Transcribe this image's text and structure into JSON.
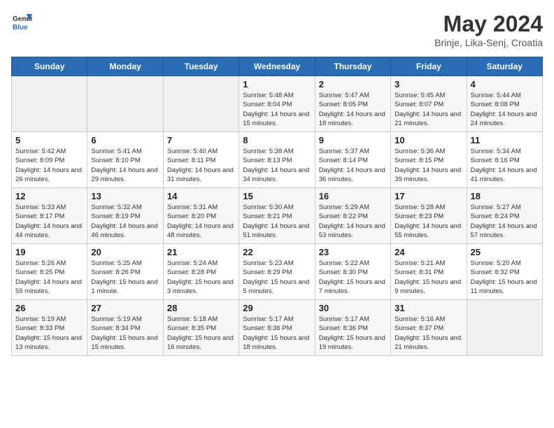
{
  "logo": {
    "general": "General",
    "blue": "Blue"
  },
  "header": {
    "month": "May 2024",
    "location": "Brinje, Lika-Senj, Croatia"
  },
  "days_of_week": [
    "Sunday",
    "Monday",
    "Tuesday",
    "Wednesday",
    "Thursday",
    "Friday",
    "Saturday"
  ],
  "weeks": [
    [
      {
        "day": "",
        "info": ""
      },
      {
        "day": "",
        "info": ""
      },
      {
        "day": "",
        "info": ""
      },
      {
        "day": "1",
        "info": "Sunrise: 5:48 AM\nSunset: 8:04 PM\nDaylight: 14 hours and 15 minutes."
      },
      {
        "day": "2",
        "info": "Sunrise: 5:47 AM\nSunset: 8:05 PM\nDaylight: 14 hours and 18 minutes."
      },
      {
        "day": "3",
        "info": "Sunrise: 5:45 AM\nSunset: 8:07 PM\nDaylight: 14 hours and 21 minutes."
      },
      {
        "day": "4",
        "info": "Sunrise: 5:44 AM\nSunset: 8:08 PM\nDaylight: 14 hours and 24 minutes."
      }
    ],
    [
      {
        "day": "5",
        "info": "Sunrise: 5:42 AM\nSunset: 8:09 PM\nDaylight: 14 hours and 26 minutes."
      },
      {
        "day": "6",
        "info": "Sunrise: 5:41 AM\nSunset: 8:10 PM\nDaylight: 14 hours and 29 minutes."
      },
      {
        "day": "7",
        "info": "Sunrise: 5:40 AM\nSunset: 8:11 PM\nDaylight: 14 hours and 31 minutes."
      },
      {
        "day": "8",
        "info": "Sunrise: 5:38 AM\nSunset: 8:13 PM\nDaylight: 14 hours and 34 minutes."
      },
      {
        "day": "9",
        "info": "Sunrise: 5:37 AM\nSunset: 8:14 PM\nDaylight: 14 hours and 36 minutes."
      },
      {
        "day": "10",
        "info": "Sunrise: 5:36 AM\nSunset: 8:15 PM\nDaylight: 14 hours and 39 minutes."
      },
      {
        "day": "11",
        "info": "Sunrise: 5:34 AM\nSunset: 8:16 PM\nDaylight: 14 hours and 41 minutes."
      }
    ],
    [
      {
        "day": "12",
        "info": "Sunrise: 5:33 AM\nSunset: 8:17 PM\nDaylight: 14 hours and 44 minutes."
      },
      {
        "day": "13",
        "info": "Sunrise: 5:32 AM\nSunset: 8:19 PM\nDaylight: 14 hours and 46 minutes."
      },
      {
        "day": "14",
        "info": "Sunrise: 5:31 AM\nSunset: 8:20 PM\nDaylight: 14 hours and 48 minutes."
      },
      {
        "day": "15",
        "info": "Sunrise: 5:30 AM\nSunset: 8:21 PM\nDaylight: 14 hours and 51 minutes."
      },
      {
        "day": "16",
        "info": "Sunrise: 5:29 AM\nSunset: 8:22 PM\nDaylight: 14 hours and 53 minutes."
      },
      {
        "day": "17",
        "info": "Sunrise: 5:28 AM\nSunset: 8:23 PM\nDaylight: 14 hours and 55 minutes."
      },
      {
        "day": "18",
        "info": "Sunrise: 5:27 AM\nSunset: 8:24 PM\nDaylight: 14 hours and 57 minutes."
      }
    ],
    [
      {
        "day": "19",
        "info": "Sunrise: 5:26 AM\nSunset: 8:25 PM\nDaylight: 14 hours and 59 minutes."
      },
      {
        "day": "20",
        "info": "Sunrise: 5:25 AM\nSunset: 8:26 PM\nDaylight: 15 hours and 1 minute."
      },
      {
        "day": "21",
        "info": "Sunrise: 5:24 AM\nSunset: 8:28 PM\nDaylight: 15 hours and 3 minutes."
      },
      {
        "day": "22",
        "info": "Sunrise: 5:23 AM\nSunset: 8:29 PM\nDaylight: 15 hours and 5 minutes."
      },
      {
        "day": "23",
        "info": "Sunrise: 5:22 AM\nSunset: 8:30 PM\nDaylight: 15 hours and 7 minutes."
      },
      {
        "day": "24",
        "info": "Sunrise: 5:21 AM\nSunset: 8:31 PM\nDaylight: 15 hours and 9 minutes."
      },
      {
        "day": "25",
        "info": "Sunrise: 5:20 AM\nSunset: 8:32 PM\nDaylight: 15 hours and 11 minutes."
      }
    ],
    [
      {
        "day": "26",
        "info": "Sunrise: 5:19 AM\nSunset: 8:33 PM\nDaylight: 15 hours and 13 minutes."
      },
      {
        "day": "27",
        "info": "Sunrise: 5:19 AM\nSunset: 8:34 PM\nDaylight: 15 hours and 15 minutes."
      },
      {
        "day": "28",
        "info": "Sunrise: 5:18 AM\nSunset: 8:35 PM\nDaylight: 15 hours and 16 minutes."
      },
      {
        "day": "29",
        "info": "Sunrise: 5:17 AM\nSunset: 8:36 PM\nDaylight: 15 hours and 18 minutes."
      },
      {
        "day": "30",
        "info": "Sunrise: 5:17 AM\nSunset: 8:36 PM\nDaylight: 15 hours and 19 minutes."
      },
      {
        "day": "31",
        "info": "Sunrise: 5:16 AM\nSunset: 8:37 PM\nDaylight: 15 hours and 21 minutes."
      },
      {
        "day": "",
        "info": ""
      }
    ]
  ]
}
